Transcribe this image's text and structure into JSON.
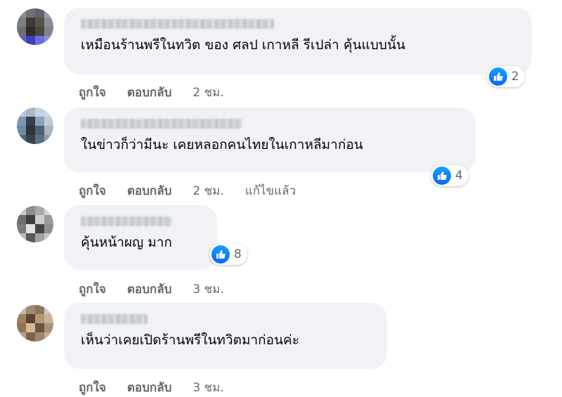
{
  "comments": [
    {
      "text": "เหมือนร้านพรีในทวิต ของ ศลป เกาหลี รีเปล่า คุ้นแบบนั้น",
      "reactions": "2",
      "like": "ถูกใจ",
      "reply": "ตอบกลับ",
      "time": "2 ชม.",
      "edited": ""
    },
    {
      "text": "ในข่าวก็ว่ามีนะ เคยหลอกคนไทยในเกาหลีมาก่อน",
      "reactions": "4",
      "like": "ถูกใจ",
      "reply": "ตอบกลับ",
      "time": "2 ชม.",
      "edited": "แก้ไขแล้ว"
    },
    {
      "text": "คุ้นหน้าผญ มาก",
      "reactions": "8",
      "like": "ถูกใจ",
      "reply": "ตอบกลับ",
      "time": "3 ชม.",
      "edited": ""
    },
    {
      "text": "เห็นว่าเคยเปิดร้านพรีในทวิตมาก่อนค่ะ",
      "reactions": "",
      "like": "ถูกใจ",
      "reply": "ตอบกลับ",
      "time": "3 ชม.",
      "edited": ""
    }
  ],
  "colors": {
    "bubble": "#f0f2f5",
    "like_blue": "#0866ff",
    "meta_text": "#65676b"
  }
}
